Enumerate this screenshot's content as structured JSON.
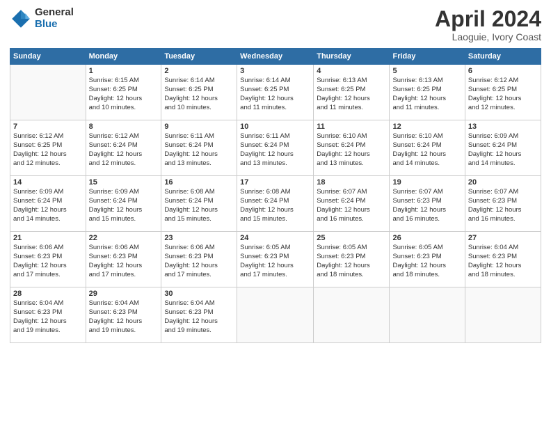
{
  "header": {
    "logo_line1": "General",
    "logo_line2": "Blue",
    "month_title": "April 2024",
    "subtitle": "Laoguie, Ivory Coast"
  },
  "days_of_week": [
    "Sunday",
    "Monday",
    "Tuesday",
    "Wednesday",
    "Thursday",
    "Friday",
    "Saturday"
  ],
  "weeks": [
    [
      {
        "day": null,
        "info": null
      },
      {
        "day": "1",
        "info": "Sunrise: 6:15 AM\nSunset: 6:25 PM\nDaylight: 12 hours\nand 10 minutes."
      },
      {
        "day": "2",
        "info": "Sunrise: 6:14 AM\nSunset: 6:25 PM\nDaylight: 12 hours\nand 10 minutes."
      },
      {
        "day": "3",
        "info": "Sunrise: 6:14 AM\nSunset: 6:25 PM\nDaylight: 12 hours\nand 11 minutes."
      },
      {
        "day": "4",
        "info": "Sunrise: 6:13 AM\nSunset: 6:25 PM\nDaylight: 12 hours\nand 11 minutes."
      },
      {
        "day": "5",
        "info": "Sunrise: 6:13 AM\nSunset: 6:25 PM\nDaylight: 12 hours\nand 11 minutes."
      },
      {
        "day": "6",
        "info": "Sunrise: 6:12 AM\nSunset: 6:25 PM\nDaylight: 12 hours\nand 12 minutes."
      }
    ],
    [
      {
        "day": "7",
        "info": "Sunrise: 6:12 AM\nSunset: 6:25 PM\nDaylight: 12 hours\nand 12 minutes."
      },
      {
        "day": "8",
        "info": "Sunrise: 6:12 AM\nSunset: 6:24 PM\nDaylight: 12 hours\nand 12 minutes."
      },
      {
        "day": "9",
        "info": "Sunrise: 6:11 AM\nSunset: 6:24 PM\nDaylight: 12 hours\nand 13 minutes."
      },
      {
        "day": "10",
        "info": "Sunrise: 6:11 AM\nSunset: 6:24 PM\nDaylight: 12 hours\nand 13 minutes."
      },
      {
        "day": "11",
        "info": "Sunrise: 6:10 AM\nSunset: 6:24 PM\nDaylight: 12 hours\nand 13 minutes."
      },
      {
        "day": "12",
        "info": "Sunrise: 6:10 AM\nSunset: 6:24 PM\nDaylight: 12 hours\nand 14 minutes."
      },
      {
        "day": "13",
        "info": "Sunrise: 6:09 AM\nSunset: 6:24 PM\nDaylight: 12 hours\nand 14 minutes."
      }
    ],
    [
      {
        "day": "14",
        "info": "Sunrise: 6:09 AM\nSunset: 6:24 PM\nDaylight: 12 hours\nand 14 minutes."
      },
      {
        "day": "15",
        "info": "Sunrise: 6:09 AM\nSunset: 6:24 PM\nDaylight: 12 hours\nand 15 minutes."
      },
      {
        "day": "16",
        "info": "Sunrise: 6:08 AM\nSunset: 6:24 PM\nDaylight: 12 hours\nand 15 minutes."
      },
      {
        "day": "17",
        "info": "Sunrise: 6:08 AM\nSunset: 6:24 PM\nDaylight: 12 hours\nand 15 minutes."
      },
      {
        "day": "18",
        "info": "Sunrise: 6:07 AM\nSunset: 6:24 PM\nDaylight: 12 hours\nand 16 minutes."
      },
      {
        "day": "19",
        "info": "Sunrise: 6:07 AM\nSunset: 6:23 PM\nDaylight: 12 hours\nand 16 minutes."
      },
      {
        "day": "20",
        "info": "Sunrise: 6:07 AM\nSunset: 6:23 PM\nDaylight: 12 hours\nand 16 minutes."
      }
    ],
    [
      {
        "day": "21",
        "info": "Sunrise: 6:06 AM\nSunset: 6:23 PM\nDaylight: 12 hours\nand 17 minutes."
      },
      {
        "day": "22",
        "info": "Sunrise: 6:06 AM\nSunset: 6:23 PM\nDaylight: 12 hours\nand 17 minutes."
      },
      {
        "day": "23",
        "info": "Sunrise: 6:06 AM\nSunset: 6:23 PM\nDaylight: 12 hours\nand 17 minutes."
      },
      {
        "day": "24",
        "info": "Sunrise: 6:05 AM\nSunset: 6:23 PM\nDaylight: 12 hours\nand 17 minutes."
      },
      {
        "day": "25",
        "info": "Sunrise: 6:05 AM\nSunset: 6:23 PM\nDaylight: 12 hours\nand 18 minutes."
      },
      {
        "day": "26",
        "info": "Sunrise: 6:05 AM\nSunset: 6:23 PM\nDaylight: 12 hours\nand 18 minutes."
      },
      {
        "day": "27",
        "info": "Sunrise: 6:04 AM\nSunset: 6:23 PM\nDaylight: 12 hours\nand 18 minutes."
      }
    ],
    [
      {
        "day": "28",
        "info": "Sunrise: 6:04 AM\nSunset: 6:23 PM\nDaylight: 12 hours\nand 19 minutes."
      },
      {
        "day": "29",
        "info": "Sunrise: 6:04 AM\nSunset: 6:23 PM\nDaylight: 12 hours\nand 19 minutes."
      },
      {
        "day": "30",
        "info": "Sunrise: 6:04 AM\nSunset: 6:23 PM\nDaylight: 12 hours\nand 19 minutes."
      },
      {
        "day": null,
        "info": null
      },
      {
        "day": null,
        "info": null
      },
      {
        "day": null,
        "info": null
      },
      {
        "day": null,
        "info": null
      }
    ]
  ]
}
